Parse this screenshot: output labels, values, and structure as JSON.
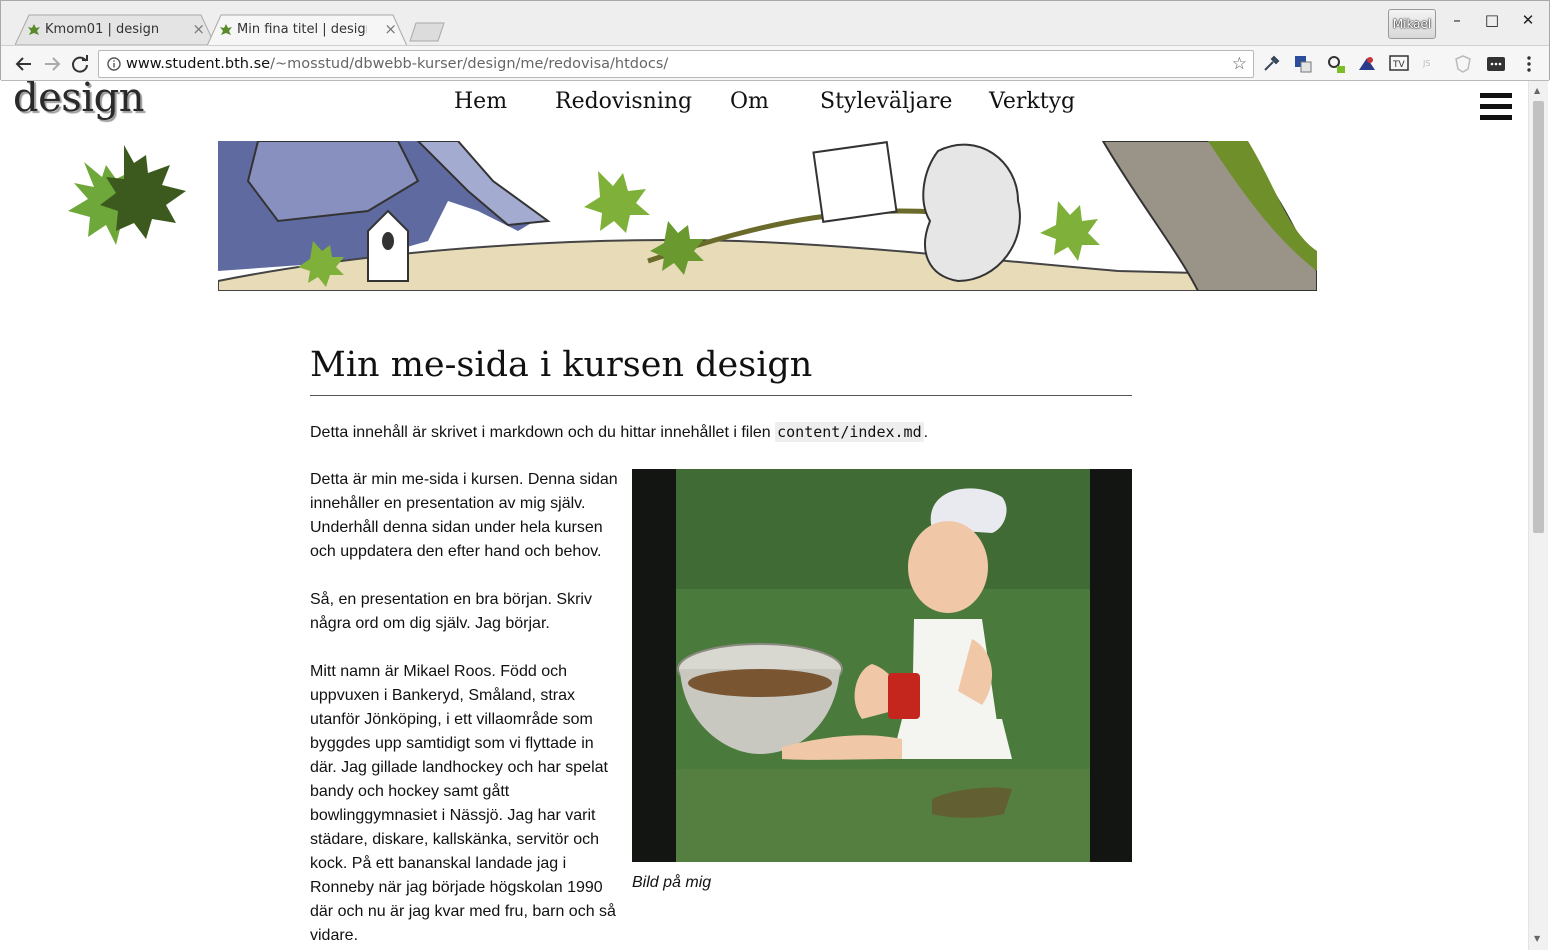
{
  "browser": {
    "tabs": [
      {
        "title": "Kmom01 | design",
        "active": false
      },
      {
        "title": "Min fina titel | design",
        "active": true
      }
    ],
    "profile_name": "Mikael",
    "url_host": "www.student.bth.se",
    "url_path": "/~mosstud/dbwebb-kurser/design/me/redovisa/htdocs/",
    "controls": {
      "minimize": "–",
      "maximize": "□",
      "close": "✕"
    }
  },
  "site": {
    "title": "design",
    "nav": [
      "Hem",
      "Redovisning",
      "Om",
      "Styleväljare",
      "Verktyg"
    ]
  },
  "article": {
    "heading": "Min me-sida i kursen design",
    "intro_text": "Detta innehåll är skrivet i markdown och du hittar innehållet i filen ",
    "intro_code": "content/index.md",
    "intro_end": ".",
    "paragraphs": [
      "Detta är min me-sida i kursen. Denna sidan innehåller en presentation av mig själv. Underhåll denna sidan under hela kursen och uppdatera den efter hand och behov.",
      "Så, en presentation en bra början. Skriv några ord om dig själv. Jag börjar.",
      "Mitt namn är Mikael Roos. Född och uppvuxen i Bankeryd, Småland, strax utanför Jönköping, i ett villaområde som byggdes upp samtidigt som vi flyttade in där. Jag gillade landhockey och har spelat bandy och hockey samt gått bowlinggymnasiet i Nässjö. Jag har varit städare, diskare, kallskänka, servitör och kock. På ett bananskal landade jag i Ronneby när jag började högskolan 1990 där och nu är jag kvar med fru, barn och så vidare."
    ],
    "image_caption": "Bild på mig"
  },
  "colors": {
    "leaf_dark": "#3d5a1e",
    "leaf_light": "#6fa83a",
    "grass": "#4a7a3c",
    "banner_blue": "#5f6aa0"
  },
  "icons": [
    "back-icon",
    "forward-icon",
    "reload-icon",
    "info-icon",
    "star-icon",
    "hamburger-icon"
  ]
}
